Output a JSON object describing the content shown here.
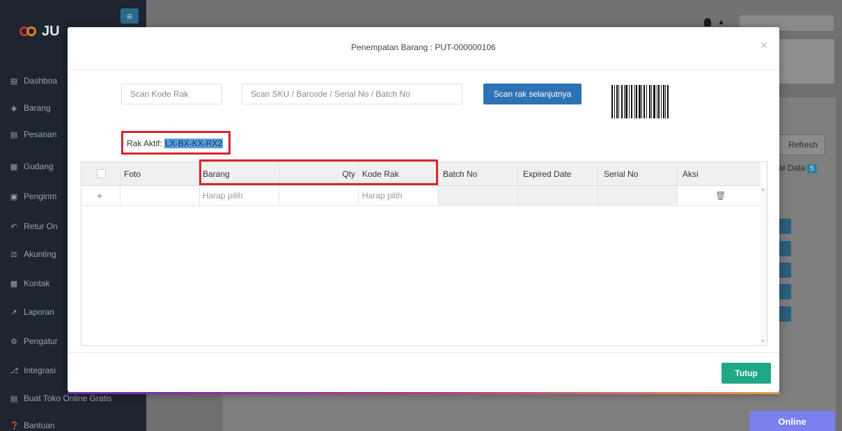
{
  "app": {
    "logo_text": "JU"
  },
  "sidebar": {
    "items": [
      {
        "label": "Dashboa",
        "icon": "chart-icon"
      },
      {
        "label": "Barang",
        "icon": "cubes-icon"
      },
      {
        "label": "Pesanan",
        "icon": "basket-icon"
      },
      {
        "label": "Gudang",
        "icon": "warehouse-icon"
      },
      {
        "label": "Pengirim",
        "icon": "truck-icon"
      },
      {
        "label": "Retur On",
        "icon": "return-icon"
      },
      {
        "label": "Akunting",
        "icon": "scale-icon"
      },
      {
        "label": "Kontak",
        "icon": "contact-card-icon"
      },
      {
        "label": "Laporan",
        "icon": "line-chart-icon"
      },
      {
        "label": "Pengatur",
        "icon": "cogs-icon"
      },
      {
        "label": "Integrasi",
        "icon": "plug-icon"
      },
      {
        "label": "Buat Toko Online Gratis",
        "icon": "cart-icon"
      },
      {
        "label": "Bantuan",
        "icon": "question-icon"
      }
    ]
  },
  "background": {
    "refresh_label": "Refresh",
    "total_label": "al Data",
    "total_count": "5",
    "online_label": "Online"
  },
  "modal": {
    "title": "Penempatan Barang : PUT-000000106",
    "scan_rak_placeholder": "Scan Kode Rak",
    "scan_sku_placeholder": "Scan SKU / Barcode / Serial No / Batch No",
    "scan_next_label": "Scan rak selanjutnya",
    "rak_aktif_label": "Rak Aktif:",
    "rak_aktif_value": "LX-BX-KX-RX2",
    "columns": [
      "Foto",
      "Barang",
      "Qty",
      "Kode Rak",
      "Batch No",
      "Expired Date",
      "Serial No",
      "Aksi"
    ],
    "row": {
      "barang": "Harap pilih",
      "kode_rak": "Harap pilih"
    },
    "close_label": "Tutup"
  }
}
